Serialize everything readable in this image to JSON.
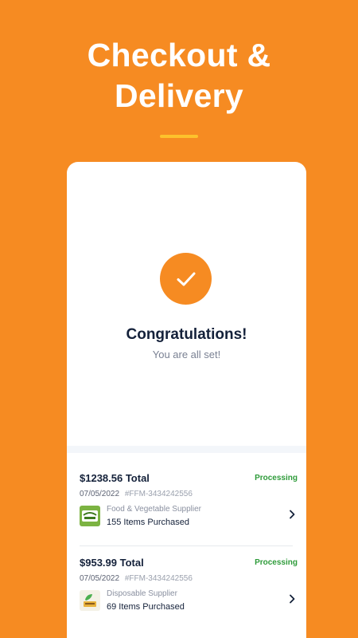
{
  "header": {
    "title_line1": "Checkout &",
    "title_line2": "Delivery"
  },
  "confirmation": {
    "icon": "check-icon",
    "title": "Congratulations!",
    "subtitle": "You are all set!"
  },
  "orders": [
    {
      "total": "$1238.56 Total",
      "status": "Processing",
      "date": "07/05/2022",
      "order_number": "#FFM-3434242556",
      "supplier": "Food & Vegetable Supplier",
      "items": "155 Items Purchased"
    },
    {
      "total": "$953.99 Total",
      "status": "Processing",
      "date": "07/05/2022",
      "order_number": "#FFM-3434242556",
      "supplier": "Disposable Supplier",
      "items": "69 Items Purchased"
    }
  ],
  "colors": {
    "background": "#F68B22",
    "accent_rule": "#FDC22C",
    "status_green": "#2E9B3A",
    "text_dark": "#14213A"
  }
}
